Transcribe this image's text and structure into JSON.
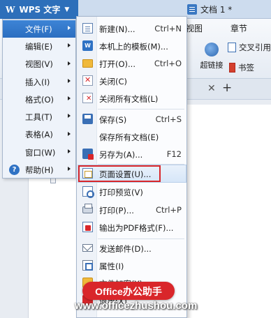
{
  "app": {
    "logo": "W",
    "name": "WPS 文字",
    "document_title": "文档 1 *"
  },
  "ribbon": {
    "tabs": [
      "视图",
      "章节"
    ],
    "hyperlink_label": "超链接",
    "cross_ref_label": "交叉引用",
    "bookmark_label": "书签"
  },
  "doc_tabs": {
    "close_glyph": "✕",
    "new_glyph": "+"
  },
  "main_menu": {
    "items": [
      {
        "label": "文件(F)",
        "has_submenu": true,
        "active": true
      },
      {
        "label": "编辑(E)",
        "has_submenu": true
      },
      {
        "label": "视图(V)",
        "has_submenu": true
      },
      {
        "label": "插入(I)",
        "has_submenu": true
      },
      {
        "label": "格式(O)",
        "has_submenu": true
      },
      {
        "label": "工具(T)",
        "has_submenu": true
      },
      {
        "label": "表格(A)",
        "has_submenu": true
      },
      {
        "label": "窗口(W)",
        "has_submenu": true
      },
      {
        "label": "帮助(H)",
        "has_submenu": true,
        "icon": "help-icon"
      }
    ]
  },
  "file_menu": {
    "items": [
      {
        "label": "新建(N)...",
        "shortcut": "Ctrl+N",
        "icon": "new-document-icon"
      },
      {
        "label": "本机上的模板(M)...",
        "shortcut": "",
        "icon": "template-icon"
      },
      {
        "label": "打开(O)...",
        "shortcut": "Ctrl+O",
        "icon": "folder-open-icon"
      },
      {
        "label": "关闭(C)",
        "shortcut": "",
        "icon": "close-document-icon"
      },
      {
        "label": "关闭所有文档(L)",
        "shortcut": "",
        "icon": "close-all-icon"
      },
      {
        "label": "保存(S)",
        "shortcut": "Ctrl+S",
        "icon": "save-icon"
      },
      {
        "label": "保存所有文档(E)",
        "shortcut": "",
        "icon": ""
      },
      {
        "label": "另存为(A)...",
        "shortcut": "F12",
        "icon": "save-as-icon"
      },
      {
        "label": "页面设置(U)...",
        "shortcut": "",
        "icon": "page-setup-icon",
        "highlighted": true
      },
      {
        "label": "打印预览(V)",
        "shortcut": "",
        "icon": "print-preview-icon"
      },
      {
        "label": "打印(P)...",
        "shortcut": "Ctrl+P",
        "icon": "print-icon"
      },
      {
        "label": "输出为PDF格式(F)...",
        "shortcut": "",
        "icon": "pdf-icon"
      },
      {
        "label": "发送邮件(D)...",
        "shortcut": "",
        "icon": "mail-icon"
      },
      {
        "label": "属性(I)",
        "shortcut": "",
        "icon": "properties-icon"
      },
      {
        "label": "文件加密(Y)...",
        "shortcut": "",
        "icon": "encrypt-icon"
      },
      {
        "label": "退出(X)",
        "shortcut": "",
        "icon": "exit-icon"
      }
    ]
  },
  "watermark": {
    "badge": "Office办公助手",
    "url": "www.officezhushou.com"
  },
  "colors": {
    "accent": "#2d6fba",
    "highlight_border": "#d9262a"
  }
}
